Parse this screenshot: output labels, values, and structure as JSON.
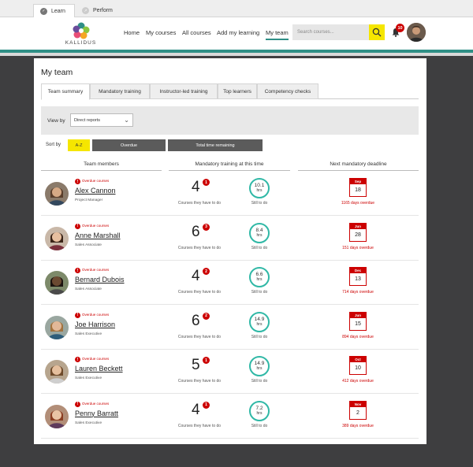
{
  "app_tabs": [
    {
      "label": "Learn",
      "icon": "learn-icon",
      "active": true
    },
    {
      "label": "Perform",
      "icon": "perform-icon",
      "active": false
    }
  ],
  "logo_text": "KALLIDUS",
  "nav": [
    "Home",
    "My courses",
    "All courses",
    "Add my learning",
    "My team"
  ],
  "nav_active": "My team",
  "search_placeholder": "Search courses...",
  "notifications": "10",
  "page_title": "My team",
  "tabs": [
    "Team summary",
    "Mandatory training",
    "Instructor-led training",
    "Top learners",
    "Competency checks"
  ],
  "active_tab": "Team summary",
  "filter": {
    "label": "View by",
    "value": "Direct reports"
  },
  "sort": {
    "label": "Sort by",
    "options": [
      "A-Z",
      "Overdue",
      "Total time remaining"
    ],
    "active": "A-Z"
  },
  "columns": [
    "Team members",
    "Mandatory training at this time",
    "Next mandatory deadline"
  ],
  "labels": {
    "overdue_flag": "Overdue courses",
    "courses": "Courses they have to do",
    "still": "Still to do",
    "hrs": "hrs"
  },
  "colors": {
    "accent": "#2f8f86",
    "ring": "#30b8a6",
    "alert": "#cc0000",
    "highlight": "#f5e600"
  },
  "members": [
    {
      "name": "Alex Cannon",
      "role": "Project Manager",
      "courses": "4",
      "overdue_count": "1",
      "hours": "10.1",
      "month": "Sep",
      "day": "18",
      "overdue_text": "1165 days overdue"
    },
    {
      "name": "Anne Marshall",
      "role": "Sales Associate",
      "courses": "6",
      "overdue_count": "3",
      "hours": "8.4",
      "month": "Jun",
      "day": "28",
      "overdue_text": "151 days overdue"
    },
    {
      "name": "Bernard Dubois",
      "role": "Sales Associate",
      "courses": "4",
      "overdue_count": "2",
      "hours": "6.6",
      "month": "Dec",
      "day": "13",
      "overdue_text": "714 days overdue"
    },
    {
      "name": "Joe Harrison",
      "role": "Sales Executive",
      "courses": "6",
      "overdue_count": "2",
      "hours": "14.9",
      "month": "Jun",
      "day": "15",
      "overdue_text": "894 days overdue"
    },
    {
      "name": "Lauren Beckett",
      "role": "Sales Executive",
      "courses": "5",
      "overdue_count": "1",
      "hours": "14.9",
      "month": "Oct",
      "day": "10",
      "overdue_text": "412 days overdue"
    },
    {
      "name": "Penny Barratt",
      "role": "Sales Executive",
      "courses": "4",
      "overdue_count": "1",
      "hours": "7.2",
      "month": "Nov",
      "day": "2",
      "overdue_text": "389 days overdue"
    }
  ]
}
